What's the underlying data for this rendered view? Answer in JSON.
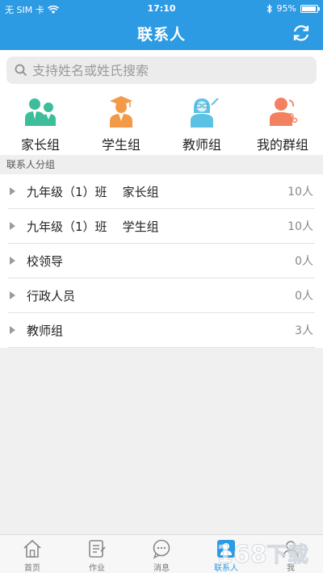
{
  "status_bar": {
    "carrier": "无 SIM 卡",
    "time": "17:10",
    "battery": "95%",
    "battery_level": 0.95
  },
  "header": {
    "title": "联系人",
    "refresh_icon": "refresh-icon"
  },
  "search": {
    "placeholder": "支持姓名或姓氏搜索"
  },
  "groups": [
    {
      "label": "家长组",
      "icon": "parents-icon",
      "color": "#3dbd9a"
    },
    {
      "label": "学生组",
      "icon": "student-icon",
      "color": "#f39a49"
    },
    {
      "label": "教师组",
      "icon": "teacher-icon",
      "color": "#5bc2e6"
    },
    {
      "label": "我的群组",
      "icon": "my-group-icon",
      "color": "#f3805e"
    }
  ],
  "section_title": "联系人分组",
  "contact_groups": [
    {
      "name": "九年级（1）班    家长组",
      "count": "10人"
    },
    {
      "name": "九年级（1）班    学生组",
      "count": "10人"
    },
    {
      "name": "校领导",
      "count": "0人"
    },
    {
      "name": "行政人员",
      "count": "0人"
    },
    {
      "name": "教师组",
      "count": "3人"
    }
  ],
  "tabbar": [
    {
      "label": "首页",
      "icon": "home-icon",
      "active": false
    },
    {
      "label": "作业",
      "icon": "homework-icon",
      "active": false
    },
    {
      "label": "消息",
      "icon": "message-icon",
      "active": false
    },
    {
      "label": "联系人",
      "icon": "contacts-icon",
      "active": true
    },
    {
      "label": "我",
      "icon": "me-icon",
      "active": false
    }
  ],
  "watermark": "168下载",
  "colors": {
    "primary": "#2c9be3",
    "background": "#f0f0f0"
  }
}
